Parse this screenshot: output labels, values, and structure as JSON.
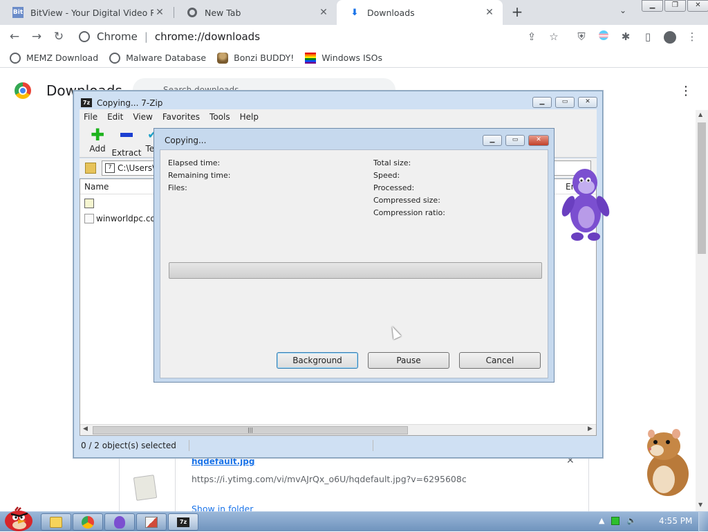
{
  "browser": {
    "tabs": [
      {
        "label": "BitView - Your Digital Video Re",
        "icon": "bitview-icon",
        "favicon_text": "Bit"
      },
      {
        "label": "New Tab",
        "icon": "chrome-icon"
      },
      {
        "label": "Downloads",
        "icon": "download-icon",
        "active": true
      }
    ],
    "omnibox": {
      "origin": "Chrome",
      "url": "chrome://downloads"
    },
    "bookmarks": [
      {
        "label": "MEMZ Download",
        "icon": "globe-icon"
      },
      {
        "label": "Malware Database",
        "icon": "globe-icon"
      },
      {
        "label": "Bonzi BUDDY!",
        "icon": "bonzi-icon"
      },
      {
        "label": "Windows ISOs",
        "icon": "rainbow-flag-icon"
      }
    ]
  },
  "downloads_page": {
    "title": "Downloads",
    "search_placeholder": "Search downloads",
    "item": {
      "filename": "hqdefault.jpg",
      "url": "https://i.ytimg.com/vi/mvAJrQx_o6U/hqdefault.jpg?v=6295608c",
      "show_in_folder": "Show in folder"
    }
  },
  "zip_window": {
    "title": "Copying... 7-Zip",
    "icon_text": "7z",
    "menu": [
      "File",
      "Edit",
      "View",
      "Favorites",
      "Tools",
      "Help"
    ],
    "toolbar": [
      {
        "label": "Add",
        "icon": "plus-icon"
      },
      {
        "label": "Extract",
        "icon": "minus-icon"
      },
      {
        "label": "Tes",
        "icon": "check-icon"
      }
    ],
    "address": "C:\\Users\\",
    "list_headers": {
      "name": "Name",
      "end": "En"
    },
    "rows": [
      {
        "name": "",
        "icon": "iso-file-icon"
      },
      {
        "name": "winworldpc.con",
        "icon": "file-icon"
      }
    ],
    "status": "0 / 2 object(s) selected"
  },
  "copy_dialog": {
    "title": "Copying...",
    "left_labels": [
      "Elapsed time:",
      "Remaining time:",
      "Files:"
    ],
    "right_labels": [
      "Total size:",
      "Speed:",
      "Processed:",
      "Compressed size:",
      "Compression ratio:"
    ],
    "progress": 0,
    "buttons": {
      "background": "Background",
      "pause": "Pause",
      "cancel": "Cancel"
    }
  },
  "taskbar": {
    "clock": "4:55 PM",
    "apps": [
      "explorer-icon",
      "chrome-icon",
      "bonzi-icon",
      "paint-icon",
      "7zip-icon"
    ]
  },
  "colors": {
    "accent": "#1a73e8",
    "progress_fill": "#06b025",
    "taskbar": "#7ea2c9"
  }
}
